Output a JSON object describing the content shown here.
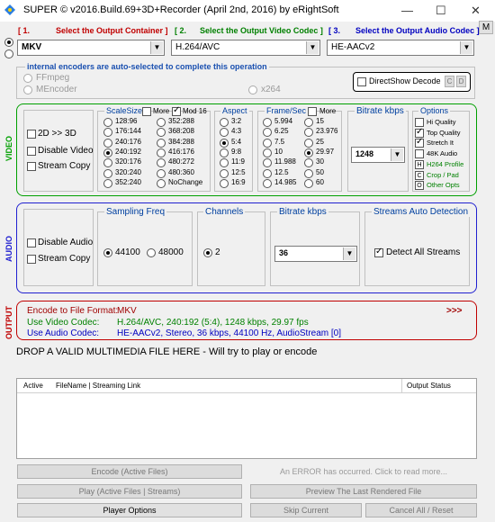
{
  "window": {
    "title": "SUPER © v2016.Build.69+3D+Recorder (April 2nd, 2016) by eRightSoft",
    "minimize": "—",
    "maximize": "☐",
    "close": "✕",
    "corner_button": "M"
  },
  "steps": {
    "s1_num": "[ 1.",
    "s1_text": "Select the Output Container ]",
    "s2_num": "[ 2.",
    "s2_text": "Select the Output Video Codec ]",
    "s3_num": "[ 3.",
    "s3_text": "Select the Output Audio Codec ]"
  },
  "selectors": {
    "container": "MKV",
    "video_codec": "H.264/AVC",
    "audio_codec": "HE-AACv2"
  },
  "encoders": {
    "title": "internal encoders are auto-selected to complete this operation",
    "ffmpeg": "FFmpeg",
    "mencoder": "MEncoder",
    "x264": "x264",
    "directshow": "DirectShow Decode",
    "ds_c": "C",
    "ds_d": "D"
  },
  "video": {
    "side_label": "VIDEO",
    "opt_3d": "2D >> 3D",
    "disable": "Disable Video",
    "stream_copy": "Stream Copy",
    "scalesize_label": "ScaleSize",
    "more_label": "More",
    "mod_label": "Mod 16",
    "sizes_col1": [
      "128:96",
      "176:144",
      "240:176",
      "240:192",
      "320:176",
      "320:240",
      "352:240"
    ],
    "sizes_col2": [
      "352:288",
      "368:208",
      "384:288",
      "416:176",
      "480:272",
      "480:360",
      "NoChange"
    ],
    "aspect_label": "Aspect",
    "aspects": [
      "3:2",
      "4:3",
      "5:4",
      "9:8",
      "11:9",
      "12:5",
      "16:9"
    ],
    "fps_label": "Frame/Sec",
    "fps_more": "More",
    "fps_col1": [
      "5.994",
      "6.25",
      "7.5",
      "10",
      "11.988",
      "12.5",
      "14.985"
    ],
    "fps_col2": [
      "15",
      "23.976",
      "25",
      "29.97",
      "30",
      "50",
      "60"
    ],
    "bitrate_label": "Bitrate  kbps",
    "bitrate_value": "1248",
    "options_label": "Options",
    "opt_hi": "Hi Quality",
    "opt_top": "Top Quality",
    "opt_stretch": "Stretch It",
    "opt_48k": "48K Audio",
    "opt_h264": "H264 Profile",
    "opt_crop": "Crop / Pad",
    "opt_other": "Other Opts",
    "icon_h": "H",
    "icon_c": "C",
    "icon_o": "O"
  },
  "audio": {
    "side_label": "AUDIO",
    "disable": "Disable Audio",
    "stream_copy": "Stream Copy",
    "freq_label": "Sampling Freq",
    "freq1": "44100",
    "freq2": "48000",
    "channels_label": "Channels",
    "channels": "2",
    "bitrate_label": "Bitrate  kbps",
    "bitrate_value": "36",
    "detect_label": "Streams Auto Detection",
    "detect": "Detect All Streams"
  },
  "output": {
    "side_label": "OUTPUT",
    "format_label": "Encode to File Format:",
    "format_value": "MKV",
    "more": ">>>",
    "vcodec_label": "Use Video Codec:",
    "vcodec_value": "H.264/AVC,  240:192 (5:4),  1248 kbps,  29.97 fps",
    "acodec_label": "Use Audio Codec:",
    "acodec_value": "HE-AACv2,  Stereo,  36 kbps,  44100 Hz,  AudioStream [0]"
  },
  "drop_text": "DROP A VALID MULTIMEDIA FILE HERE - Will try to play or encode",
  "table": {
    "col_active": "Active",
    "col_filename": "FileName  |  Streaming Link",
    "col_status": "Output Status"
  },
  "buttons": {
    "encode": "Encode (Active Files)",
    "error": "An ERROR has occurred. Click to read more...",
    "play": "Play (Active Files | Streams)",
    "preview": "Preview The Last Rendered File",
    "player_options": "Player Options",
    "skip": "Skip Current",
    "cancel": "Cancel All  /  Reset"
  },
  "colors": {
    "video_border": "#00a000",
    "audio_border": "#2020d0",
    "output_border": "#c00000"
  }
}
